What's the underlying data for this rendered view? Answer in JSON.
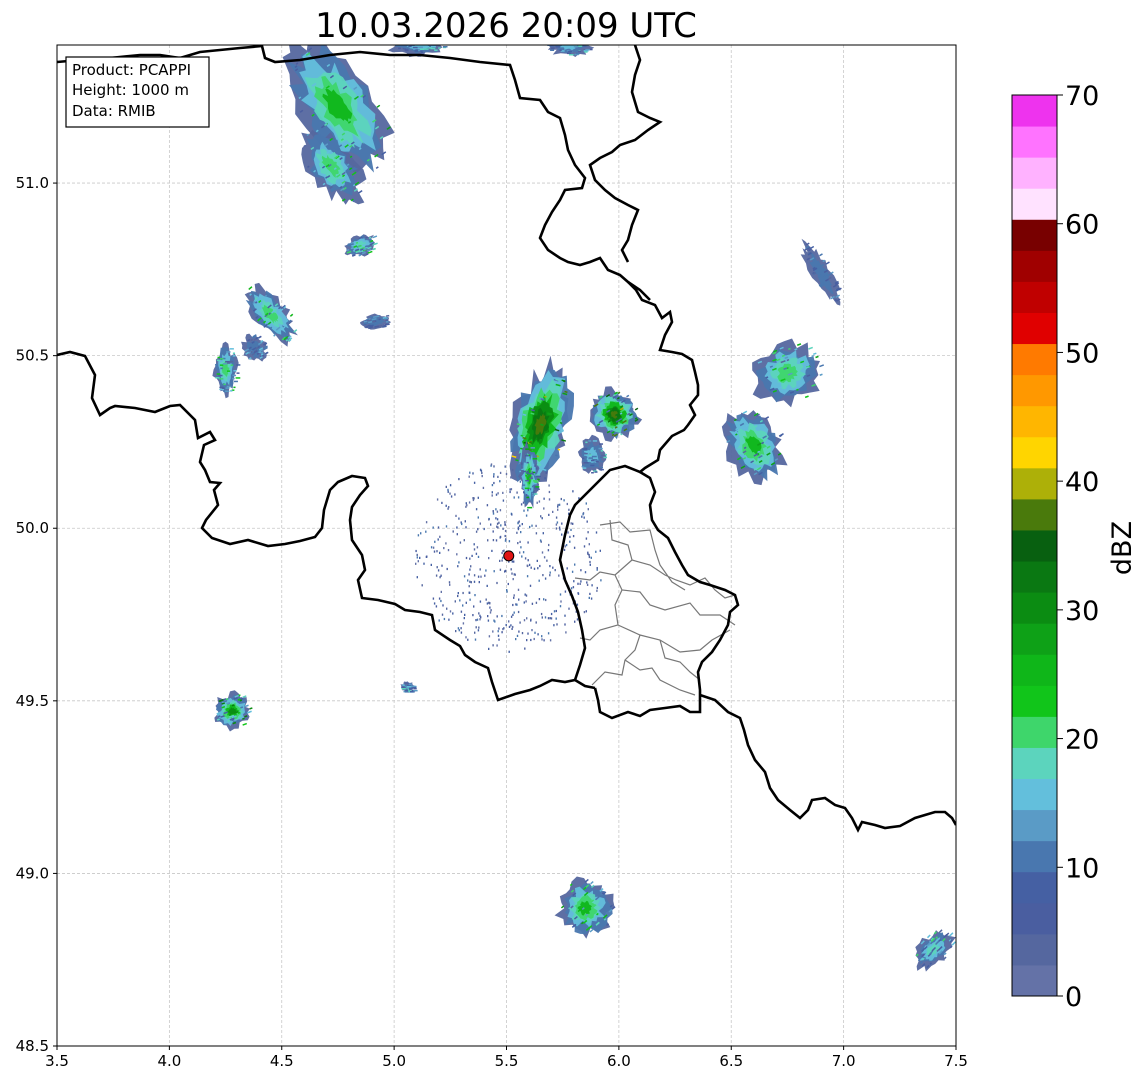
{
  "title": "10.03.2026 20:09 UTC",
  "info_box": {
    "product": "Product: PCAPPI",
    "height": "Height: 1000 m",
    "data": "Data: RMIB"
  },
  "map_extent": {
    "lon": [
      3.5,
      7.5
    ],
    "lat": [
      48.5,
      51.4
    ]
  },
  "x_ticks": [
    "3.5",
    "4.0",
    "4.5",
    "5.0",
    "5.5",
    "6.0",
    "6.5",
    "7.0",
    "7.5"
  ],
  "x_tick_values": [
    3.5,
    4.0,
    4.5,
    5.0,
    5.5,
    6.0,
    6.5,
    7.0,
    7.5
  ],
  "y_ticks": [
    "48.5",
    "49.0",
    "49.5",
    "50.0",
    "50.5",
    "51.0"
  ],
  "y_tick_values": [
    48.5,
    49.0,
    49.5,
    50.0,
    50.5,
    51.0
  ],
  "radar_site": {
    "lon": 5.51,
    "lat": 49.92
  },
  "colorbar": {
    "label": "dBZ",
    "ticks": [
      "0",
      "10",
      "20",
      "30",
      "40",
      "50",
      "60",
      "70"
    ],
    "tick_values": [
      0,
      10,
      20,
      30,
      40,
      50,
      60,
      70
    ],
    "bins": [
      "#6472a7",
      "#55679f",
      "#4a5ea0",
      "#4560a3",
      "#4977af",
      "#5a9bc6",
      "#63bfdc",
      "#5cd4bd",
      "#3ed66b",
      "#11c51a",
      "#0fb619",
      "#0ea117",
      "#0b8c12",
      "#0a7812",
      "#086010",
      "#4a7a0c",
      "#adb008",
      "#ffd500",
      "#ffb600",
      "#ff9800",
      "#ff7a00",
      "#e00000",
      "#c00000",
      "#a00000",
      "#780000",
      "#ffe2ff",
      "#ffb2ff",
      "#ff73ff",
      "#ee33ee"
    ]
  },
  "echoes": [
    {
      "lon": 4.75,
      "lat": 51.22,
      "rx": 0.16,
      "ry": 0.22,
      "rot": -35,
      "peak": 26
    },
    {
      "lon": 4.72,
      "lat": 51.05,
      "rx": 0.1,
      "ry": 0.12,
      "rot": -35,
      "peak": 24
    },
    {
      "lon": 4.85,
      "lat": 50.82,
      "rx": 0.07,
      "ry": 0.03,
      "rot": -20,
      "peak": 20
    },
    {
      "lon": 4.45,
      "lat": 50.62,
      "rx": 0.07,
      "ry": 0.1,
      "rot": -40,
      "peak": 22
    },
    {
      "lon": 4.38,
      "lat": 50.52,
      "rx": 0.05,
      "ry": 0.04,
      "rot": -30,
      "peak": 14
    },
    {
      "lon": 4.25,
      "lat": 50.46,
      "rx": 0.05,
      "ry": 0.07,
      "rot": 0,
      "peak": 22
    },
    {
      "lon": 4.92,
      "lat": 50.6,
      "rx": 0.06,
      "ry": 0.02,
      "rot": -10,
      "peak": 12
    },
    {
      "lon": 5.65,
      "lat": 50.3,
      "rx": 0.13,
      "ry": 0.17,
      "rot": 15,
      "peak": 40
    },
    {
      "lon": 5.6,
      "lat": 50.15,
      "rx": 0.04,
      "ry": 0.09,
      "rot": 0,
      "peak": 26
    },
    {
      "lon": 5.98,
      "lat": 50.33,
      "rx": 0.1,
      "ry": 0.07,
      "rot": -30,
      "peak": 38
    },
    {
      "lon": 5.88,
      "lat": 50.21,
      "rx": 0.06,
      "ry": 0.05,
      "rot": 0,
      "peak": 16
    },
    {
      "lon": 6.75,
      "lat": 50.45,
      "rx": 0.15,
      "ry": 0.09,
      "rot": -20,
      "peak": 24
    },
    {
      "lon": 6.6,
      "lat": 50.24,
      "rx": 0.12,
      "ry": 0.11,
      "rot": -30,
      "peak": 28
    },
    {
      "lon": 6.9,
      "lat": 50.74,
      "rx": 0.04,
      "ry": 0.1,
      "rot": -30,
      "peak": 10
    },
    {
      "lon": 4.28,
      "lat": 49.47,
      "rx": 0.08,
      "ry": 0.05,
      "rot": -20,
      "peak": 30
    },
    {
      "lon": 5.06,
      "lat": 49.54,
      "rx": 0.03,
      "ry": 0.015,
      "rot": 0,
      "peak": 16
    },
    {
      "lon": 5.85,
      "lat": 48.9,
      "rx": 0.12,
      "ry": 0.08,
      "rot": -40,
      "peak": 26
    },
    {
      "lon": 7.4,
      "lat": 48.78,
      "rx": 0.1,
      "ry": 0.04,
      "rot": -45,
      "peak": 18
    },
    {
      "lon": 5.78,
      "lat": 51.4,
      "rx": 0.1,
      "ry": 0.03,
      "rot": 0,
      "peak": 16
    },
    {
      "lon": 5.1,
      "lat": 51.4,
      "rx": 0.12,
      "ry": 0.03,
      "rot": 0,
      "peak": 16
    }
  ]
}
